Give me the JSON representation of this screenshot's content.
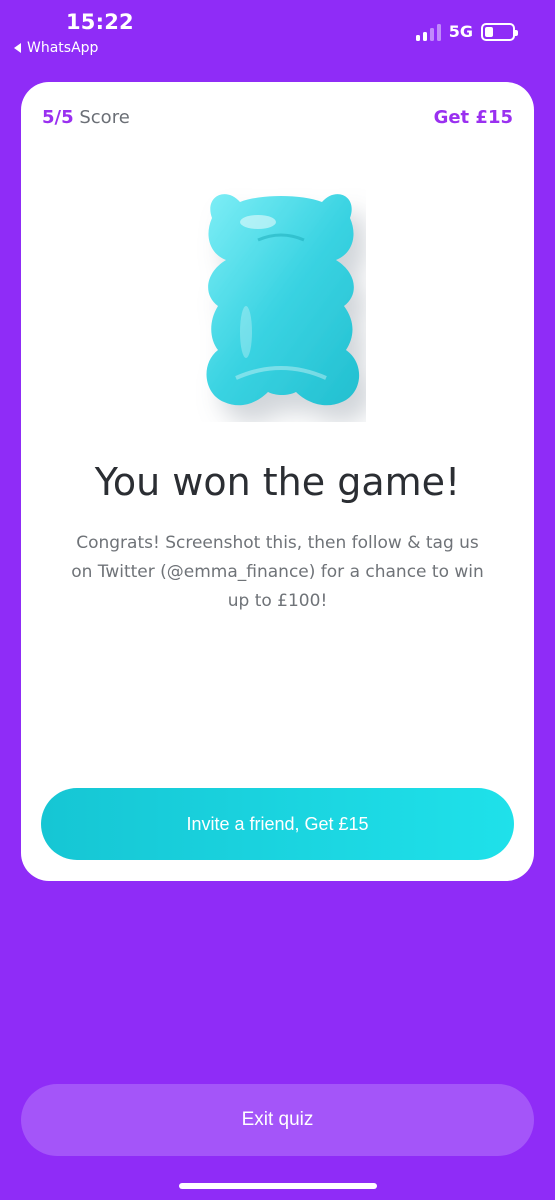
{
  "status_bar": {
    "time": "15:22",
    "back_app": "WhatsApp",
    "network": "5G",
    "signal_icon": "signal-bars-icon",
    "battery_icon": "battery-icon"
  },
  "card": {
    "score_value": "5/5",
    "score_label": "Score",
    "get_reward": "Get £15",
    "image_icon": "gummy-bear-icon",
    "title": "You won the game!",
    "message": "Congrats! Screenshot this, then follow & tag us on Twitter (@emma_finance) for a chance to win up to £100!",
    "invite_button": "Invite a friend, Get £15"
  },
  "footer": {
    "exit_button": "Exit quiz"
  },
  "colors": {
    "background": "#8f2cf7",
    "accent_purple": "#9a30f0",
    "invite_gradient_start": "#16c6d4",
    "invite_gradient_end": "#1fe1ea",
    "exit_button": "#a455f9",
    "bear": "#3ad3e2"
  }
}
